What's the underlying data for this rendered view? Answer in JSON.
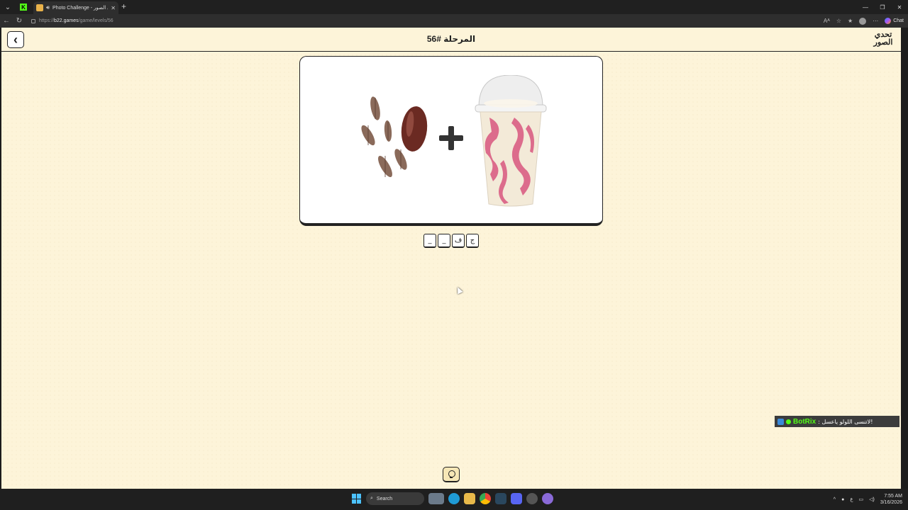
{
  "browser": {
    "tab_title": "Photo Challenge - تحدي الصور",
    "tab_close": "✕",
    "new_tab": "+",
    "url_prefix": "https://",
    "url_host": "b22.games",
    "url_path": "/game/levels/56",
    "chat_label": "Chat",
    "window_controls": [
      "—",
      "❐",
      "✕"
    ]
  },
  "header": {
    "back_glyph": "‹",
    "level_title": "المرحلة #56",
    "logo_line1": "تحدي",
    "logo_line2": "الصور"
  },
  "puzzle": {
    "left_image": "dates-fruit",
    "right_image": "strawberry-milkshake-cup",
    "operator": "plus"
  },
  "answer_letters": [
    "ج",
    "ف",
    "_",
    "_"
  ],
  "overlay": {
    "bot_name": "BotRix",
    "bot_message": ": لاتنسى اللولو ياعسل!"
  },
  "taskbar": {
    "search_label": "Search",
    "time": "7:55 AM",
    "date": "3/16/2026",
    "lang": "ع"
  },
  "colors": {
    "page_bg": "#fdf4d9",
    "ink": "#222222",
    "bot_green": "#53fc18"
  }
}
